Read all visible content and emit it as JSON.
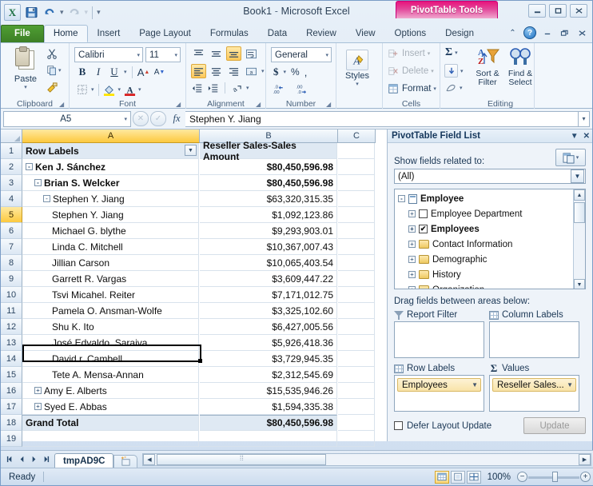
{
  "titlebar": {
    "app_icon": "excel-logo",
    "quick_access": [
      {
        "name": "save",
        "glyph": "💾"
      },
      {
        "name": "undo",
        "glyph": "↶"
      },
      {
        "name": "redo",
        "glyph": "↷"
      }
    ],
    "document_title": "Book1",
    "separator": "-",
    "app_name": "Microsoft Excel",
    "contextual_tab": "PivotTable Tools",
    "window_buttons": [
      "–",
      "□",
      "✕"
    ]
  },
  "ribbon": {
    "tabs": [
      {
        "label": "File",
        "active": false,
        "kind": "file"
      },
      {
        "label": "Home",
        "active": true
      },
      {
        "label": "Insert",
        "active": false
      },
      {
        "label": "Page Layout",
        "active": false
      },
      {
        "label": "Formulas",
        "active": false
      },
      {
        "label": "Data",
        "active": false
      },
      {
        "label": "Review",
        "active": false
      },
      {
        "label": "View",
        "active": false
      },
      {
        "label": "Options",
        "active": false
      },
      {
        "label": "Design",
        "active": false
      }
    ],
    "help_glyph": "?",
    "collapse_glyph": "⌃",
    "groups": {
      "clipboard": {
        "label": "Clipboard",
        "paste": "Paste",
        "cut_glyph": "✂",
        "copy_glyph": "❐",
        "format_painter_glyph": "🖌"
      },
      "font": {
        "label": "Font",
        "font_name": "Calibri",
        "font_size": "11",
        "bold": "B",
        "italic": "I",
        "underline": "U",
        "grow": "A",
        "shrink": "A",
        "borders_glyph": "⌸",
        "fill_glyph": "▰",
        "color_glyph": "A"
      },
      "alignment": {
        "label": "Alignment"
      },
      "number": {
        "label": "Number",
        "format": "General",
        "currency": "$",
        "percent": "%",
        "comma": ",",
        "inc_dec": ".00",
        "dec_dec": ".00"
      },
      "styles": {
        "label": "Styles",
        "styles": "Styles"
      },
      "cells": {
        "label": "Cells",
        "insert": "Insert",
        "delete": "Delete",
        "format": "Format"
      },
      "editing": {
        "label": "Editing",
        "autosum": "Σ",
        "fill": "⬇",
        "clear": "⌫",
        "sort_filter": "Sort &\nFilter",
        "sort_filter_l1": "Sort &",
        "sort_filter_l2": "Filter",
        "find_select_l1": "Find &",
        "find_select_l2": "Select"
      }
    }
  },
  "formula_bar": {
    "name_box": "A5",
    "fx_label": "fx",
    "formula_value": "Stephen Y. Jiang",
    "cancel_glyph": "✕",
    "accept_glyph": "✓"
  },
  "grid": {
    "columns": [
      {
        "id": "A",
        "label": "A",
        "selected": true
      },
      {
        "id": "B",
        "label": "B",
        "selected": false
      },
      {
        "id": "C",
        "label": "C",
        "selected": false
      }
    ],
    "selected_cell_row": 5,
    "rows": [
      {
        "num": "1",
        "a": "Row Labels",
        "b": "Reseller Sales-Sales Amount",
        "indent": 0,
        "toggle": "",
        "style": "header"
      },
      {
        "num": "2",
        "a": "Ken J. Sánchez",
        "b": "$80,450,596.98",
        "indent": 0,
        "toggle": "-",
        "style": "bold"
      },
      {
        "num": "3",
        "a": "Brian S. Welcker",
        "b": "$80,450,596.98",
        "indent": 1,
        "toggle": "-",
        "style": "bold"
      },
      {
        "num": "4",
        "a": "Stephen Y. Jiang",
        "b": "$63,320,315.35",
        "indent": 2,
        "toggle": "-",
        "style": "normal"
      },
      {
        "num": "5",
        "a": "Stephen Y. Jiang",
        "b": "$1,092,123.86",
        "indent": 3,
        "toggle": "",
        "style": "normal"
      },
      {
        "num": "6",
        "a": "Michael G. blythe",
        "b": "$9,293,903.01",
        "indent": 3,
        "toggle": "",
        "style": "normal"
      },
      {
        "num": "7",
        "a": "Linda C. Mitchell",
        "b": "$10,367,007.43",
        "indent": 3,
        "toggle": "",
        "style": "normal"
      },
      {
        "num": "8",
        "a": "Jillian Carson",
        "b": "$10,065,403.54",
        "indent": 3,
        "toggle": "",
        "style": "normal"
      },
      {
        "num": "9",
        "a": "Garrett R. Vargas",
        "b": "$3,609,447.22",
        "indent": 3,
        "toggle": "",
        "style": "normal"
      },
      {
        "num": "10",
        "a": "Tsvi Micahel. Reiter",
        "b": "$7,171,012.75",
        "indent": 3,
        "toggle": "",
        "style": "normal"
      },
      {
        "num": "11",
        "a": "Pamela O. Ansman-Wolfe",
        "b": "$3,325,102.60",
        "indent": 3,
        "toggle": "",
        "style": "normal"
      },
      {
        "num": "12",
        "a": "Shu K. Ito",
        "b": "$6,427,005.56",
        "indent": 3,
        "toggle": "",
        "style": "normal"
      },
      {
        "num": "13",
        "a": "José Edvaldo. Saraiva",
        "b": "$5,926,418.36",
        "indent": 3,
        "toggle": "",
        "style": "normal"
      },
      {
        "num": "14",
        "a": "David r. Cambell",
        "b": "$3,729,945.35",
        "indent": 3,
        "toggle": "",
        "style": "normal"
      },
      {
        "num": "15",
        "a": "Tete A. Mensa-Annan",
        "b": "$2,312,545.69",
        "indent": 3,
        "toggle": "",
        "style": "normal"
      },
      {
        "num": "16",
        "a": "Amy E. Alberts",
        "b": "$15,535,946.26",
        "indent": 1,
        "toggle": "+",
        "style": "normal"
      },
      {
        "num": "17",
        "a": "Syed E. Abbas",
        "b": "$1,594,335.38",
        "indent": 1,
        "toggle": "+",
        "style": "normal"
      },
      {
        "num": "18",
        "a": "Grand Total",
        "b": "$80,450,596.98",
        "indent": 0,
        "toggle": "",
        "style": "total"
      },
      {
        "num": "19",
        "a": "",
        "b": "",
        "indent": 0,
        "toggle": "",
        "style": "normal"
      }
    ]
  },
  "field_list": {
    "title": "PivotTable Field List",
    "minimize_glyph": "▼",
    "close_glyph": "✕",
    "show_fields_label": "Show fields related to:",
    "selected_source": "(All)",
    "tree": [
      {
        "label": "Employee",
        "kind": "table",
        "toggle": "-",
        "checked": null,
        "bold": true,
        "indent": 0
      },
      {
        "label": "Employee Department",
        "kind": "checkbox",
        "toggle": "+",
        "checked": false,
        "bold": false,
        "indent": 1
      },
      {
        "label": "Employees",
        "kind": "checkbox",
        "toggle": "+",
        "checked": true,
        "bold": true,
        "indent": 1
      },
      {
        "label": "Contact Information",
        "kind": "folder",
        "toggle": "+",
        "checked": null,
        "bold": false,
        "indent": 1
      },
      {
        "label": "Demographic",
        "kind": "folder",
        "toggle": "+",
        "checked": null,
        "bold": false,
        "indent": 1
      },
      {
        "label": "History",
        "kind": "folder",
        "toggle": "+",
        "checked": null,
        "bold": false,
        "indent": 1
      },
      {
        "label": "Organization",
        "kind": "folder",
        "toggle": "+",
        "checked": null,
        "bold": false,
        "indent": 1
      }
    ],
    "drag_label": "Drag fields between areas below:",
    "areas": {
      "report_filter": {
        "title": "Report Filter",
        "icon": "funnel-icon",
        "chip": ""
      },
      "column_labels": {
        "title": "Column Labels",
        "icon": "grid-icon",
        "chip": ""
      },
      "row_labels": {
        "title": "Row Labels",
        "icon": "grid-icon",
        "chip": "Employees"
      },
      "values": {
        "title": "Values",
        "icon": "sigma-icon",
        "chip": "Reseller Sales..."
      }
    },
    "defer_label": "Defer Layout Update",
    "defer_checked": false,
    "update_button": "Update"
  },
  "sheet_bar": {
    "nav_first": "◀│",
    "nav_prev": "◀",
    "nav_next": "▶",
    "nav_last": "│▶",
    "tabs": [
      {
        "label": "tmpAD9C",
        "active": true
      }
    ],
    "new_sheet_glyph": "✧"
  },
  "status_bar": {
    "status": "Ready",
    "views": [
      {
        "name": "normal-view",
        "glyph": "⊞",
        "active": true
      },
      {
        "name": "page-layout-view",
        "glyph": "▣",
        "active": false
      },
      {
        "name": "page-break-view",
        "glyph": "▥",
        "active": false
      }
    ],
    "zoom_level": "100%",
    "zoom_out": "−",
    "zoom_in": "+"
  },
  "colors": {
    "contextual_tab": "#e8147c",
    "file_tab": "#4f9e33",
    "selection_highlight": "#fcc93f",
    "chip": "#f8e3a8"
  }
}
